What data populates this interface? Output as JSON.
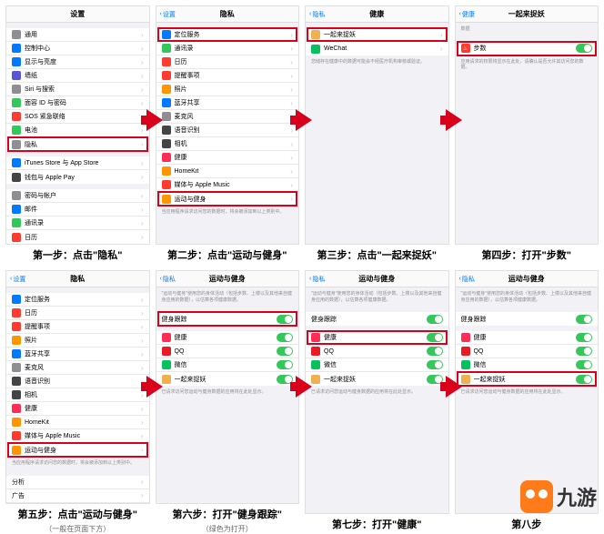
{
  "screens": [
    {
      "nav": {
        "back": "",
        "title": "设置"
      },
      "groups": [
        {
          "rows": [
            {
              "icon": "ic-gray",
              "label": "通用"
            },
            {
              "icon": "ic-blue",
              "label": "控制中心"
            },
            {
              "icon": "ic-blue",
              "label": "显示与亮度"
            },
            {
              "icon": "ic-purple",
              "label": "墙纸"
            },
            {
              "icon": "ic-gray",
              "label": "Siri 与搜索"
            },
            {
              "icon": "ic-green",
              "label": "面容 ID 与密码"
            },
            {
              "icon": "ic-red",
              "label": "SOS 紧急联络"
            },
            {
              "icon": "ic-green",
              "label": "电池"
            },
            {
              "icon": "ic-gray",
              "label": "隐私",
              "hl": true
            }
          ]
        },
        {
          "rows": [
            {
              "icon": "ic-blue",
              "label": "iTunes Store 与 App Store"
            },
            {
              "icon": "ic-dgray",
              "label": "钱包与 Apple Pay"
            }
          ]
        },
        {
          "rows": [
            {
              "icon": "ic-gray",
              "label": "密码与帐户"
            },
            {
              "icon": "ic-blue",
              "label": "邮件"
            },
            {
              "icon": "ic-green",
              "label": "通讯录"
            },
            {
              "icon": "ic-red",
              "label": "日历"
            }
          ]
        }
      ],
      "caption": "第一步：点击\"隐私\""
    },
    {
      "nav": {
        "back": "设置",
        "title": "隐私"
      },
      "groups": [
        {
          "rows": [
            {
              "icon": "ic-blue",
              "label": "定位服务",
              "hl": true
            },
            {
              "icon": "ic-green",
              "label": "通讯录"
            },
            {
              "icon": "ic-red",
              "label": "日历"
            },
            {
              "icon": "ic-red",
              "label": "提醒事项"
            },
            {
              "icon": "ic-orange",
              "label": "照片"
            },
            {
              "icon": "ic-blue",
              "label": "蓝牙共享"
            },
            {
              "icon": "ic-gray",
              "label": "麦克风"
            },
            {
              "icon": "ic-dgray",
              "label": "语音识别"
            },
            {
              "icon": "ic-dgray",
              "label": "相机"
            },
            {
              "icon": "ic-pink",
              "label": "健康"
            },
            {
              "icon": "ic-orange",
              "label": "HomeKit"
            },
            {
              "icon": "ic-red",
              "label": "媒体与 Apple Music"
            },
            {
              "icon": "ic-orange",
              "label": "运动与健身",
              "hl": true
            }
          ]
        }
      ],
      "note": "当应用程序请求访问您的数据时，将会被添加到以上类别中。",
      "caption": "第二步：点击\"运动与健身\""
    },
    {
      "nav": {
        "back": "隐私",
        "title": "健康"
      },
      "groups": [
        {
          "rows": [
            {
              "icon": "ic-app",
              "label": "一起来捉妖",
              "hl": true
            },
            {
              "icon": "ic-wechat",
              "label": "WeChat"
            }
          ]
        }
      ],
      "note": "您储存在健康中的数据可能会不经医疗机构审核或验证。",
      "caption": "第三步：点击\"一起来捉妖\""
    },
    {
      "nav": {
        "back": "健康",
        "title": "一起来捉妖"
      },
      "section_label": "数据",
      "groups": [
        {
          "rows": [
            {
              "icon": "ic-red",
              "glyph": "♨",
              "label": "步数",
              "toggle": "on",
              "hl": true
            }
          ]
        }
      ],
      "note": "应用请求的权限将显示在此处，请确认是否允许其访问您的数据。",
      "caption": "第四步：打开\"步数\""
    },
    {
      "nav": {
        "back": "设置",
        "title": "隐私"
      },
      "groups": [
        {
          "rows": [
            {
              "icon": "ic-blue",
              "label": "定位服务"
            },
            {
              "icon": "ic-red",
              "label": "日历"
            },
            {
              "icon": "ic-red",
              "label": "提醒事项"
            },
            {
              "icon": "ic-orange",
              "label": "照片"
            },
            {
              "icon": "ic-blue",
              "label": "蓝牙共享"
            },
            {
              "icon": "ic-gray",
              "label": "麦克风"
            },
            {
              "icon": "ic-dgray",
              "label": "语音识别"
            },
            {
              "icon": "ic-dgray",
              "label": "相机"
            },
            {
              "icon": "ic-pink",
              "label": "健康"
            },
            {
              "icon": "ic-orange",
              "label": "HomeKit"
            },
            {
              "icon": "ic-red",
              "label": "媒体与 Apple Music"
            },
            {
              "icon": "ic-orange",
              "label": "运动与健身",
              "hl": true
            }
          ]
        }
      ],
      "note": "当应用程序请求访问您的数据时，将会被添加到以上类别中。",
      "extras": [
        {
          "label": "分析"
        },
        {
          "label": "广告"
        }
      ],
      "caption": "第五步：点击\"运动与健身\"",
      "subcaption": "（一般在页面下方）"
    },
    {
      "nav": {
        "back": "隐私",
        "title": "运动与健身"
      },
      "note_top": "\"运动与健身\"使用您的身体活动（包括步数、上楼以及其他来自健身应用的数据），以估算各项健康数据。",
      "groups": [
        {
          "rows": [
            {
              "icon": "",
              "label": "健身跟踪",
              "toggle": "on",
              "hl": true
            }
          ]
        },
        {
          "rows": [
            {
              "icon": "ic-pink",
              "label": "健康",
              "toggle": "on"
            },
            {
              "icon": "ic-qq",
              "label": "QQ",
              "toggle": "on"
            },
            {
              "icon": "ic-wechat",
              "label": "微信",
              "toggle": "on"
            },
            {
              "icon": "ic-app",
              "label": "一起来捉妖",
              "toggle": "on"
            }
          ]
        }
      ],
      "note": "已请求访问您运动与健身数据的应用将在此处显示。",
      "caption": "第六步：打开\"健身跟踪\"",
      "subcaption": "（绿色为打开）"
    },
    {
      "nav": {
        "back": "隐私",
        "title": "运动与健身"
      },
      "note_top": "\"运动与健身\"使用您的身体活动（包括步数、上楼以及其他来自健身应用的数据），以估算各项健康数据。",
      "groups": [
        {
          "rows": [
            {
              "icon": "",
              "label": "健身跟踪",
              "toggle": "on"
            }
          ]
        },
        {
          "rows": [
            {
              "icon": "ic-pink",
              "label": "健康",
              "toggle": "on",
              "hl": true
            },
            {
              "icon": "ic-qq",
              "label": "QQ",
              "toggle": "on"
            },
            {
              "icon": "ic-wechat",
              "label": "微信",
              "toggle": "on"
            },
            {
              "icon": "ic-app",
              "label": "一起来捉妖",
              "toggle": "on"
            }
          ]
        }
      ],
      "note": "已请求访问您运动与健身数据的应用将在此处显示。",
      "caption": "第七步：打开\"健康\""
    },
    {
      "nav": {
        "back": "隐私",
        "title": "运动与健身"
      },
      "note_top": "\"运动与健身\"使用您的身体活动（包括步数、上楼以及其他来自健身应用的数据），以估算各项健康数据。",
      "groups": [
        {
          "rows": [
            {
              "icon": "",
              "label": "健身跟踪",
              "toggle": "on"
            }
          ]
        },
        {
          "rows": [
            {
              "icon": "ic-pink",
              "label": "健康",
              "toggle": "on"
            },
            {
              "icon": "ic-qq",
              "label": "QQ",
              "toggle": "on"
            },
            {
              "icon": "ic-wechat",
              "label": "微信",
              "toggle": "on"
            },
            {
              "icon": "ic-app",
              "label": "一起来捉妖",
              "toggle": "on",
              "hl": true
            }
          ]
        }
      ],
      "note": "已请求访问您运动与健身数据的应用将在此处显示。",
      "caption": "第八步"
    }
  ],
  "watermark": "九游"
}
